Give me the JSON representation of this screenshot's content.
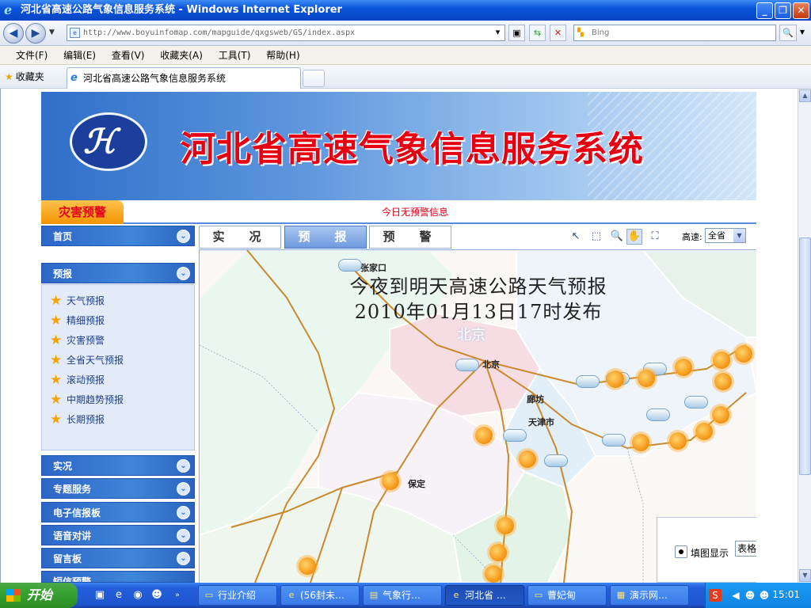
{
  "window": {
    "title": "河北省高速公路气象信息服务系统 - Windows Internet Explorer"
  },
  "address": {
    "url": "http://www.boyuinfomap.com/mapguide/qxgsweb/GS/index.aspx",
    "search_placeholder": "Bing"
  },
  "menu": [
    "文件(F)",
    "编辑(E)",
    "查看(V)",
    "收藏夹(A)",
    "工具(T)",
    "帮助(H)"
  ],
  "favorites": {
    "label": "收藏夹",
    "tab_title": "河北省高速公路气象信息服务系统"
  },
  "banner": {
    "title": "河北省高速气象信息服务系统"
  },
  "alert": {
    "label": "灾害预警",
    "message": "今日无预警信息"
  },
  "sidebar": {
    "home": "首页",
    "forecast": "预报",
    "forecast_items": [
      "天气预报",
      "精细预报",
      "灾害预警",
      "全省天气预报",
      "滚动预报",
      "中期趋势预报",
      "长期预报"
    ],
    "sections": [
      "实况",
      "专题服务",
      "电子信报板",
      "语音对讲",
      "留言板",
      "短信预警"
    ]
  },
  "tabs": {
    "live": "实　况",
    "forecast": "预　报",
    "warning": "预　警"
  },
  "highway": {
    "label": "高速:",
    "value": "全省"
  },
  "map": {
    "title_line1": "今夜到明天高速公路天气预报",
    "title_line2": "2010年01月13日17时发布",
    "cities": {
      "zhangjiakou": "张家口",
      "beijing": "北京",
      "beijing_area": "北京",
      "langfang": "廊坊",
      "tianjin": "天津市",
      "baoding": "保定"
    },
    "legend_radio": "填图显示",
    "legend_table": "表格"
  },
  "taskbar": {
    "start": "开始",
    "tasks": [
      "行业介绍",
      "(56封未…",
      "气象行…",
      "河北省 …",
      "曹妃甸",
      "演示网…"
    ],
    "clock": "15:01"
  }
}
